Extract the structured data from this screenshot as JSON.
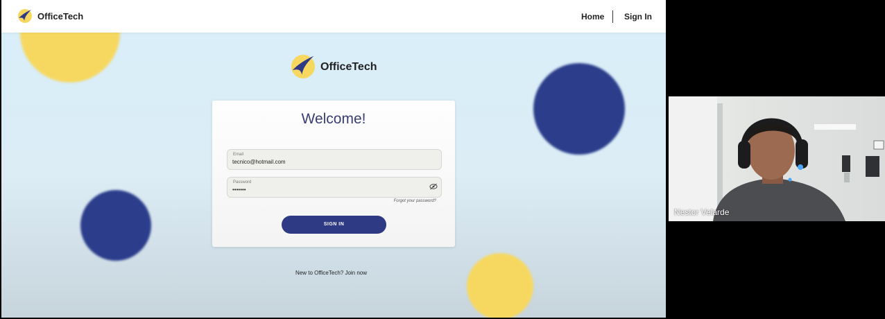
{
  "nav": {
    "brand": "OfficeTech",
    "home": "Home",
    "sign_in": "Sign In"
  },
  "hero": {
    "brand": "OfficeTech"
  },
  "card": {
    "title": "Welcome!",
    "email_label": "Email",
    "email_value": "tecnico@hotmail.com",
    "password_label": "Password",
    "password_value": "•••••••",
    "forgot": "Forgot your password?",
    "submit": "SIGN IN"
  },
  "footer": {
    "join": "New to OfficeTech? Join now"
  },
  "video": {
    "participant_name": "Nestor Velarde"
  },
  "colors": {
    "brand_blue": "#2e3a84",
    "brand_yellow": "#f6d861"
  }
}
